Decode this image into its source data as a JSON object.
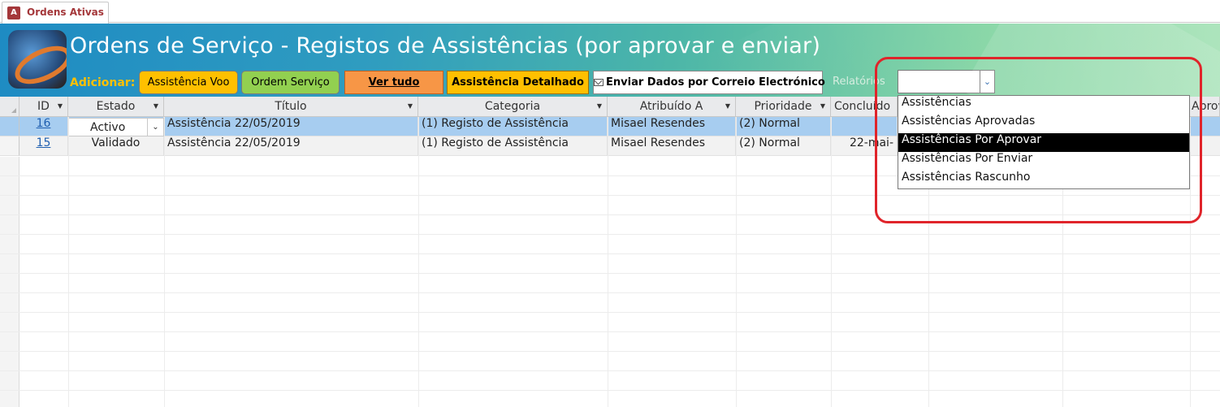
{
  "tab": {
    "label": "Ordens Ativas",
    "icon": "access-icon"
  },
  "header": {
    "title": "Ordens de Serviço - Registos de Assistências (por aprovar e enviar)",
    "adicionar_label": "Adicionar:",
    "buttons": {
      "voo": "Assistência Voo",
      "ordem": "Ordem Serviço",
      "ver_tudo": "Ver tudo",
      "detalhado": "Assistência Detalhado",
      "enviar": "Enviar Dados por Correio Electrónico"
    },
    "relatorios_label": "Relatórios",
    "relatorios_value": ""
  },
  "grid": {
    "columns": [
      "ID",
      "Estado",
      "Título",
      "Categoria",
      "Atribuído A",
      "Prioridade",
      "Concluído",
      "Aprov"
    ],
    "rows": [
      {
        "id": "16",
        "estado": "Activo",
        "titulo": "Assistência 22/05/2019",
        "categoria": "(1) Registo de Assistência",
        "atribuido": "Misael Resendes",
        "prioridade": "(2) Normal",
        "concluido": ""
      },
      {
        "id": "15",
        "estado": "Validado",
        "titulo": "Assistência 22/05/2019",
        "categoria": "(1) Registo de Assistência",
        "atribuido": "Misael Resendes",
        "prioridade": "(2) Normal",
        "concluido": "22-mai-"
      }
    ]
  },
  "dropdown": {
    "options": [
      "Assistências",
      "Assistências Aprovadas",
      "Assistências Por Aprovar",
      "Assistências Por Enviar",
      "Assistências Rascunho"
    ],
    "highlighted": "Assistências Por Aprovar"
  },
  "colors": {
    "accent_yellow": "#ffc000",
    "accent_green": "#92d050",
    "accent_orange": "#f79646",
    "selected_row": "#a7cdf0",
    "annotation_red": "#e0242a"
  }
}
